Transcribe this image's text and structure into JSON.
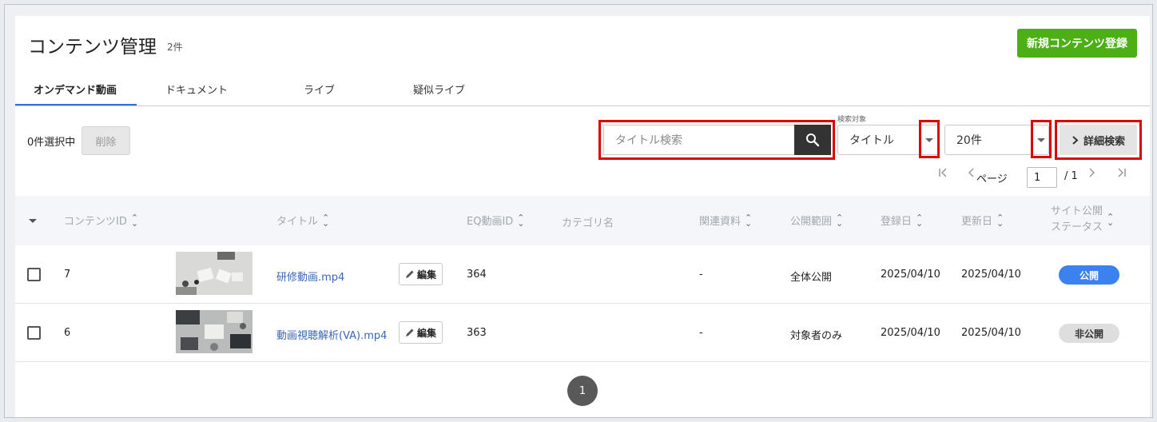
{
  "header": {
    "title": "コンテンツ管理",
    "count": "2件",
    "new_button": "新規コンテンツ登録"
  },
  "tabs": [
    {
      "label": "オンデマンド動画",
      "active": true
    },
    {
      "label": "ドキュメント",
      "active": false
    },
    {
      "label": "ライブ",
      "active": false
    },
    {
      "label": "疑似ライブ",
      "active": false
    }
  ],
  "toolbar": {
    "selected": "0件選択中",
    "delete_label": "削除",
    "search_placeholder": "タイトル検索",
    "search_target_label": "検索対象",
    "search_target_value": "タイトル",
    "per_page_value": "20件",
    "detail_search_label": "詳細検索"
  },
  "pagination_top": {
    "page_label": "ページ",
    "current": "1",
    "total": "/ 1"
  },
  "table": {
    "headers": {
      "content_id": "コンテンツID",
      "title": "タイトル",
      "eq_id": "EQ動画ID",
      "category": "カテゴリ名",
      "related": "関連資料",
      "scope": "公開範囲",
      "registered": "登録日",
      "updated": "更新日",
      "status_line1": "サイト公開",
      "status_line2": "ステータス"
    },
    "rows": [
      {
        "id": "7",
        "title": "研修動画.mp4",
        "edit": "編集",
        "eq_id": "364",
        "category": "",
        "related": "-",
        "scope": "全体公開",
        "registered": "2025/04/10",
        "updated": "2025/04/10",
        "status": "公開"
      },
      {
        "id": "6",
        "title": "動画視聴解析(VA).mp4",
        "edit": "編集",
        "eq_id": "363",
        "category": "",
        "related": "-",
        "scope": "対象者のみ",
        "registered": "2025/04/10",
        "updated": "2025/04/10",
        "status": "非公開"
      }
    ]
  },
  "pagination_bottom": {
    "current": "1"
  },
  "colors": {
    "accent_green": "#4caf16",
    "link_blue": "#3b66b5",
    "public_badge": "#3b82f0",
    "private_badge": "#dedede",
    "highlight_red": "#e00000"
  }
}
